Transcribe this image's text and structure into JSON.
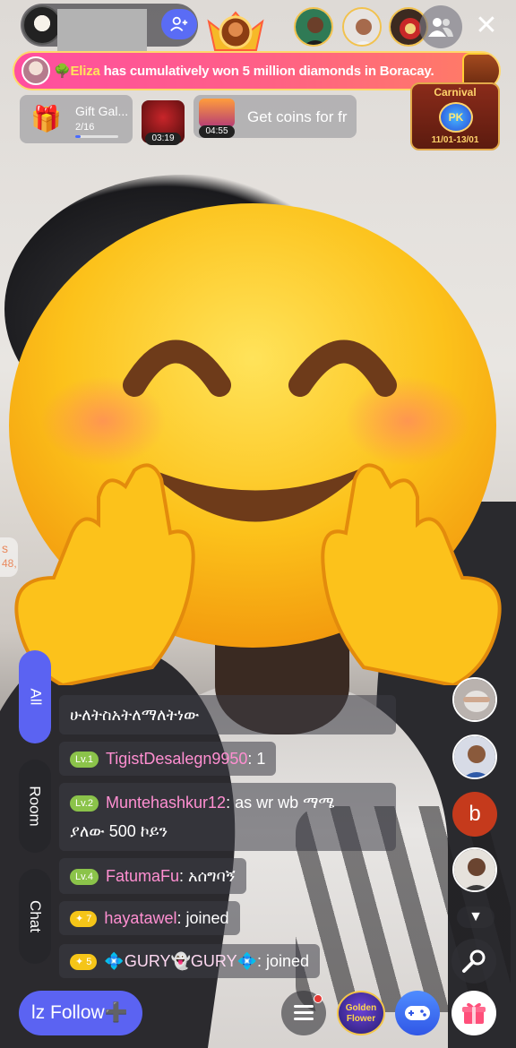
{
  "banner": {
    "name": "Eliza",
    "text": " has cumulatively won 5 million diamonds in Boracay."
  },
  "activities": {
    "gift_gallery": {
      "title": "Gift Gal...",
      "count": "2/16",
      "progress_fraction": 0.125
    },
    "timer_chest": {
      "time": "03:19"
    },
    "coins": {
      "time": "04:55",
      "text": "Get coins for fr"
    },
    "carnival": {
      "title": "Carnival",
      "badge": "PK",
      "dates": "11/01-13/01"
    }
  },
  "side_tabs": {
    "all": "All",
    "room": "Room",
    "chat": "Chat"
  },
  "chat": [
    {
      "level": "",
      "user": "",
      "text": "ሁለትስአትለማለትነው"
    },
    {
      "level": "Lv.1",
      "user": "TigistDesalegn9950",
      "text": ": 1"
    },
    {
      "level": "Lv.2",
      "user": "Muntehashkur12",
      "text": ": as wr wb ማሜ",
      "text2": "ያለው 500 ኮይን"
    },
    {
      "level": "Lv.4",
      "user": "FatumaFu",
      "text": ": አሰግባኝ"
    },
    {
      "level": "7",
      "user": "hayatawel",
      "text": ": joined"
    },
    {
      "level": "5",
      "user": "💠GURY👻GURY💠",
      "text": ": joined"
    }
  ],
  "right_column": {
    "letter_avatar": "b"
  },
  "bottom": {
    "follow_label": "lz Follow",
    "follow_icon": "➕",
    "golden_label_1": "Golden",
    "golden_label_2": "Flower"
  },
  "left_pill": {
    "line1": "s",
    "line2": "48,"
  },
  "colors": {
    "accent": "#5b63f2",
    "banner_start": "#ff4ea0",
    "banner_end": "#ff7e63",
    "username": "#ff8fd1"
  }
}
